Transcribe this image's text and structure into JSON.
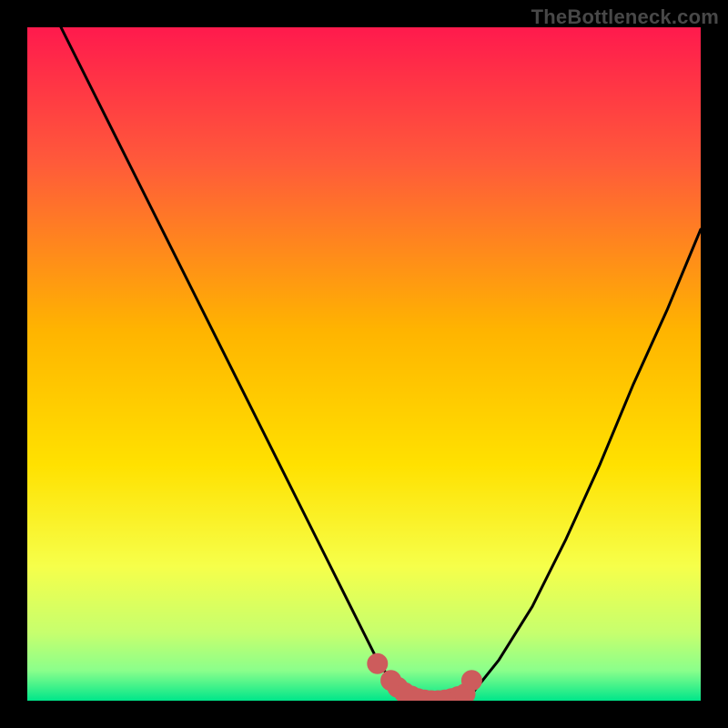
{
  "watermark": "TheBottleneck.com",
  "colors": {
    "frame": "#000000",
    "watermark_text": "#484848",
    "curve": "#000000",
    "marker_fill": "#cd5c5c",
    "marker_stroke": "#cd5c5c",
    "gradient_stops": [
      {
        "offset": 0.0,
        "color": "#ff1a4d"
      },
      {
        "offset": 0.2,
        "color": "#ff5a3a"
      },
      {
        "offset": 0.45,
        "color": "#ffb400"
      },
      {
        "offset": 0.65,
        "color": "#ffe100"
      },
      {
        "offset": 0.8,
        "color": "#f6ff4a"
      },
      {
        "offset": 0.9,
        "color": "#c6ff6e"
      },
      {
        "offset": 0.955,
        "color": "#8bff8b"
      },
      {
        "offset": 1.0,
        "color": "#00e68a"
      }
    ]
  },
  "chart_data": {
    "type": "line",
    "title": "",
    "xlabel": "",
    "ylabel": "",
    "xlim": [
      0,
      100
    ],
    "ylim": [
      0,
      100
    ],
    "series": [
      {
        "name": "bottleneck-curve",
        "x": [
          5,
          10,
          15,
          20,
          25,
          30,
          35,
          40,
          45,
          50,
          52,
          54,
          56,
          58,
          60,
          62,
          64,
          66,
          70,
          75,
          80,
          85,
          90,
          95,
          100
        ],
        "values": [
          100,
          90,
          80,
          70,
          60,
          50,
          40,
          30,
          20,
          10,
          6,
          3,
          1,
          0,
          0,
          0,
          0,
          1,
          6,
          14,
          24,
          35,
          47,
          58,
          70
        ]
      }
    ],
    "markers": {
      "name": "optimal-region",
      "x": [
        52,
        54,
        55,
        56,
        57,
        58,
        59,
        60,
        61,
        62,
        63,
        64,
        65,
        66
      ],
      "values": [
        5.5,
        3.0,
        2.0,
        1.2,
        0.7,
        0.3,
        0.1,
        0.0,
        0.0,
        0.1,
        0.3,
        0.6,
        1.0,
        3.0
      ]
    }
  }
}
